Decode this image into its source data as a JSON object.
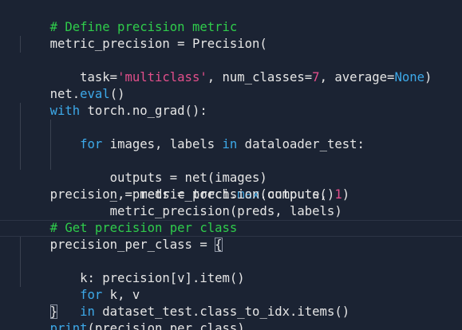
{
  "editor": {
    "lines": [
      {
        "text": "# Define precision metric"
      },
      {
        "text": "metric_precision = Precision("
      },
      {
        "text": "    task='multiclass', num_classes=7, average=None)"
      },
      {
        "text": ""
      },
      {
        "text": "net.eval()"
      },
      {
        "text": "with torch.no_grad():"
      },
      {
        "text": "    for images, labels in dataloader_test:"
      },
      {
        "text": "        outputs = net(images)"
      },
      {
        "text": "        _, preds = torch.max(outputs, 1)"
      },
      {
        "text": "        metric_precision(preds, labels)"
      },
      {
        "text": "precision = metric_precision.compute()"
      },
      {
        "text": ""
      },
      {
        "text": "# Get precision per class"
      },
      {
        "text": "precision_per_class = {"
      },
      {
        "text": "    k: precision[v].item()"
      },
      {
        "text": "    for k, v"
      },
      {
        "text": "    in dataset_test.class_to_idx.items()"
      },
      {
        "text": "}"
      },
      {
        "text": "print(precision_per_class)"
      }
    ],
    "tokens": {
      "c1": "# Define precision metric",
      "l2a": "metric_precision = Precision(",
      "l3a": "    task=",
      "l3b": "'multiclass'",
      "l3c": ", num_classes=",
      "l3d": "7",
      "l3e": ", average=",
      "l3f": "None",
      "l3g": ")",
      "l5a": "net.",
      "l5b": "eval",
      "l5c": "()",
      "l6a": "with",
      "l6b": " torch.no_grad():",
      "l7a": "    ",
      "l7b": "for",
      "l7c": " images, labels ",
      "l7d": "in",
      "l7e": " dataloader_test:",
      "l8a": "        outputs = net(images)",
      "l9a": "        _, preds = torch.",
      "l9b": "max",
      "l9c": "(outputs, ",
      "l9d": "1",
      "l9e": ")",
      "l10a": "        metric_precision(preds, labels)",
      "l11a": "precision = metric_precision.compute()",
      "c2": "# Get precision per class",
      "l14a": "precision_per_class = ",
      "l14b": "{",
      "l15a": "    k: precision[v].item()",
      "l16a": "    ",
      "l16b": "for",
      "l16c": " k, v",
      "l17a": "    ",
      "l17b": "in",
      "l17c": " dataset_test.class_to_idx.items()",
      "l18a": "}",
      "l19a": "print",
      "l19b": "(precision_per_class)"
    }
  },
  "colors": {
    "background": "#1b2333",
    "comment": "#2fcc4b",
    "keyword": "#3da9e9",
    "string": "#e24f8b",
    "number": "#e24f8b",
    "text": "#e6e6e6"
  }
}
